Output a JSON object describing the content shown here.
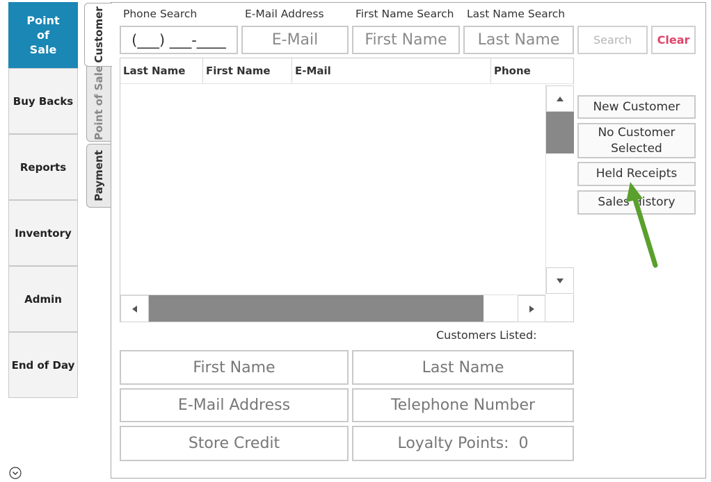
{
  "nav": {
    "items": [
      {
        "label": "Point of Sale",
        "lines": [
          "Point",
          "of",
          "Sale"
        ],
        "active": true
      },
      {
        "label": "Buy Backs"
      },
      {
        "label": "Reports"
      },
      {
        "label": "Inventory"
      },
      {
        "label": "Admin"
      },
      {
        "label": "End of Day"
      }
    ]
  },
  "tabs": [
    {
      "label": "Customer",
      "active": true
    },
    {
      "label": "Point of Sale"
    },
    {
      "label": "Payment"
    }
  ],
  "search": {
    "phone_label": "Phone Search",
    "email_label": "E-Mail Address",
    "first_label": "First Name Search",
    "last_label": "Last Name Search",
    "phone_placeholder": "(___) ___-____",
    "email_placeholder": "E-Mail",
    "first_placeholder": "First Name",
    "last_placeholder": "Last Name",
    "search_button": "Search",
    "clear_button": "Clear"
  },
  "table": {
    "columns": [
      "Last Name",
      "First Name",
      "E-Mail",
      "Phone"
    ],
    "rows": []
  },
  "actions": {
    "new_customer": "New Customer",
    "no_customer": "No Customer Selected",
    "no_customer_lines": [
      "No Customer",
      "Selected"
    ],
    "held_receipts": "Held Receipts",
    "sales_history": "Sales History"
  },
  "customers_listed_label": "Customers Listed:",
  "details": {
    "first_name": "First Name",
    "last_name": "Last Name",
    "email": "E-Mail Address",
    "telephone": "Telephone Number",
    "store_credit": "Store Credit",
    "loyalty_points": "Loyalty Points:  0"
  },
  "colors": {
    "accent": "#1a87b5",
    "clear": "#e0446a",
    "arrow": "#5aa02c",
    "scroll_thumb": "#888888"
  },
  "icons": {
    "scroll_up": "triangle-up-icon",
    "scroll_down": "triangle-down-icon",
    "scroll_left": "triangle-left-icon",
    "scroll_right": "triangle-right-icon",
    "collapse": "chevron-circle-down-icon",
    "annotation": "green-arrow-icon"
  }
}
